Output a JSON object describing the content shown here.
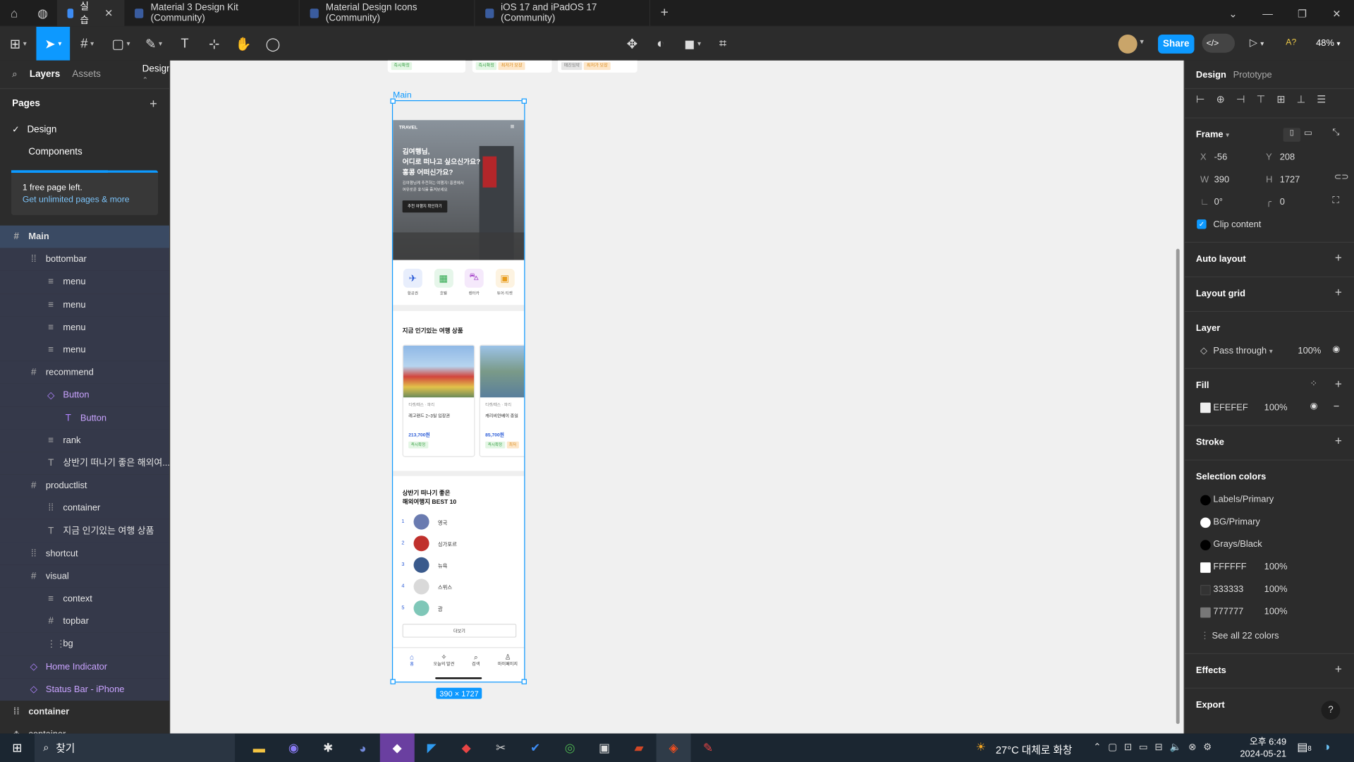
{
  "tabs": [
    {
      "label": "실습",
      "active": true
    },
    {
      "label": "Material 3 Design Kit (Community)"
    },
    {
      "label": "Material Design Icons (Community)"
    },
    {
      "label": "iOS 17 and iPadOS 17 (Community)"
    }
  ],
  "toolbar": {
    "share": "Share",
    "zoom": "48%",
    "ai": "A?"
  },
  "left": {
    "tab_layers": "Layers",
    "tab_assets": "Assets",
    "tab_design": "Design",
    "pages_title": "Pages",
    "pages": [
      "Design",
      "Components"
    ],
    "upsell_title": "1 free page left.",
    "upsell_link": "Get unlimited pages & more",
    "layers": [
      {
        "label": "Main",
        "icon": "#",
        "indent": 0,
        "sel": "main"
      },
      {
        "label": "bottombar",
        "icon": "⁞⁞",
        "indent": 1
      },
      {
        "label": "menu",
        "icon": "≡",
        "indent": 2
      },
      {
        "label": "menu",
        "icon": "≡",
        "indent": 2
      },
      {
        "label": "menu",
        "icon": "≡",
        "indent": 2
      },
      {
        "label": "menu",
        "icon": "≡",
        "indent": 2
      },
      {
        "label": "recommend",
        "icon": "#",
        "indent": 1
      },
      {
        "label": "Button",
        "icon": "◇",
        "indent": 2,
        "purple": true
      },
      {
        "label": "Button",
        "icon": "T",
        "indent": 3,
        "purple": true
      },
      {
        "label": "rank",
        "icon": "≡",
        "indent": 2
      },
      {
        "label": "상반기 떠나기 좋은 해외여...",
        "icon": "T",
        "indent": 2
      },
      {
        "label": "productlist",
        "icon": "#",
        "indent": 1
      },
      {
        "label": "container",
        "icon": "⁞⁞",
        "indent": 2
      },
      {
        "label": "지금 인기있는 여행 상품",
        "icon": "T",
        "indent": 2
      },
      {
        "label": "shortcut",
        "icon": "⁞⁞",
        "indent": 1
      },
      {
        "label": "visual",
        "icon": "#",
        "indent": 1
      },
      {
        "label": "context",
        "icon": "≡",
        "indent": 2
      },
      {
        "label": "topbar",
        "icon": "#",
        "indent": 2
      },
      {
        "label": "bg",
        "icon": "⋮⋮",
        "indent": 2
      },
      {
        "label": "Home Indicator",
        "icon": "◇",
        "indent": 1,
        "purple": true
      },
      {
        "label": "Status Bar - iPhone",
        "icon": "◇",
        "indent": 1,
        "purple": true
      },
      {
        "label": "container",
        "icon": "⁞⁞",
        "indent": 0,
        "bold": true
      },
      {
        "label": "container",
        "icon": "❖",
        "indent": 0
      }
    ]
  },
  "canvas": {
    "frame_label": "Main",
    "size_badge": "390 × 1727",
    "top_tags": [
      [
        "즉시확정"
      ],
      [
        "즉시확정",
        "최저가 보장"
      ],
      [
        "매진임박",
        "최저가 보장"
      ]
    ],
    "app": {
      "brand": "TRAVEL",
      "hero_title": [
        "김여행님,",
        "어디로 떠나고 싶으신가요?",
        "홍콩 어떠신가요?"
      ],
      "hero_sub": [
        "김여행님께 추천하는 여행지! 홍콩에서",
        "여유로운 휴식을 즐겨보세요"
      ],
      "hero_btn": "추천 여행지 확인하기",
      "shortcuts": [
        {
          "label": "항공권",
          "icon": "✈",
          "color": "#2a5bd7",
          "bg": "#e8eefc"
        },
        {
          "label": "호텔",
          "icon": "▦",
          "color": "#2fa84f",
          "bg": "#e6f6ea"
        },
        {
          "label": "렌터카",
          "icon": "⛍",
          "color": "#a33ec7",
          "bg": "#f5e9fb"
        },
        {
          "label": "투어·티켓",
          "icon": "▣",
          "color": "#e89b1a",
          "bg": "#fdf3e1"
        }
      ],
      "popular_title": "지금 인기있는 여행 상품",
      "products": [
        {
          "loc": "티켓/패스 · 파리",
          "name": "레고랜드 2~3일 입장권",
          "price": "213,700원",
          "tags": [
            "즉시확정"
          ]
        },
        {
          "loc": "티켓/패스 · 파리",
          "name": "캐리비안베이 종일",
          "price": "85,700원",
          "tags": [
            "즉시확정",
            "최저"
          ]
        }
      ],
      "rank_title": [
        "상반기 떠나기 좋은",
        "해외여행지 BEST 10"
      ],
      "ranks": [
        {
          "n": "1",
          "city": "영국",
          "color": "#6a7bb0"
        },
        {
          "n": "2",
          "city": "싱가포르",
          "color": "#c0302c"
        },
        {
          "n": "3",
          "city": "뉴욕",
          "color": "#3a5a8c"
        },
        {
          "n": "4",
          "city": "스위스",
          "color": "#d9d9d9"
        },
        {
          "n": "5",
          "city": "괌",
          "color": "#7fc7b8"
        }
      ],
      "more_btn": "더보기",
      "bottom": [
        "홈",
        "오늘의 발견",
        "검색",
        "마이페이지"
      ]
    }
  },
  "right": {
    "tab_design": "Design",
    "tab_prototype": "Prototype",
    "frame_title": "Frame",
    "x": "-56",
    "y": "208",
    "w": "390",
    "h": "1727",
    "rot": "0°",
    "radius": "0",
    "x_label": "X",
    "y_label": "Y",
    "w_label": "W",
    "h_label": "H",
    "clip": "Clip content",
    "auto_layout": "Auto layout",
    "layout_grid": "Layout grid",
    "layer_title": "Layer",
    "blend": "Pass through",
    "layer_opacity": "100%",
    "fill_title": "Fill",
    "fill_hex": "EFEFEF",
    "fill_opacity": "100%",
    "stroke_title": "Stroke",
    "selcolors_title": "Selection colors",
    "selcolors": [
      {
        "label": "Labels/Primary",
        "color": "#000000",
        "round": true
      },
      {
        "label": "BG/Primary",
        "color": "#ffffff",
        "round": true
      },
      {
        "label": "Grays/Black",
        "color": "#000000",
        "round": true
      },
      {
        "label": "FFFFFF",
        "opacity": "100%",
        "color": "#ffffff"
      },
      {
        "label": "333333",
        "opacity": "100%",
        "color": "#333333"
      },
      {
        "label": "777777",
        "opacity": "100%",
        "color": "#777777"
      }
    ],
    "see_all": "See all 22 colors",
    "effects": "Effects",
    "export": "Export"
  },
  "taskbar": {
    "search": "찾기",
    "weather": "27°C 대체로 화창",
    "time": "오후 6:49",
    "date": "2024-05-21",
    "notif": "8"
  }
}
